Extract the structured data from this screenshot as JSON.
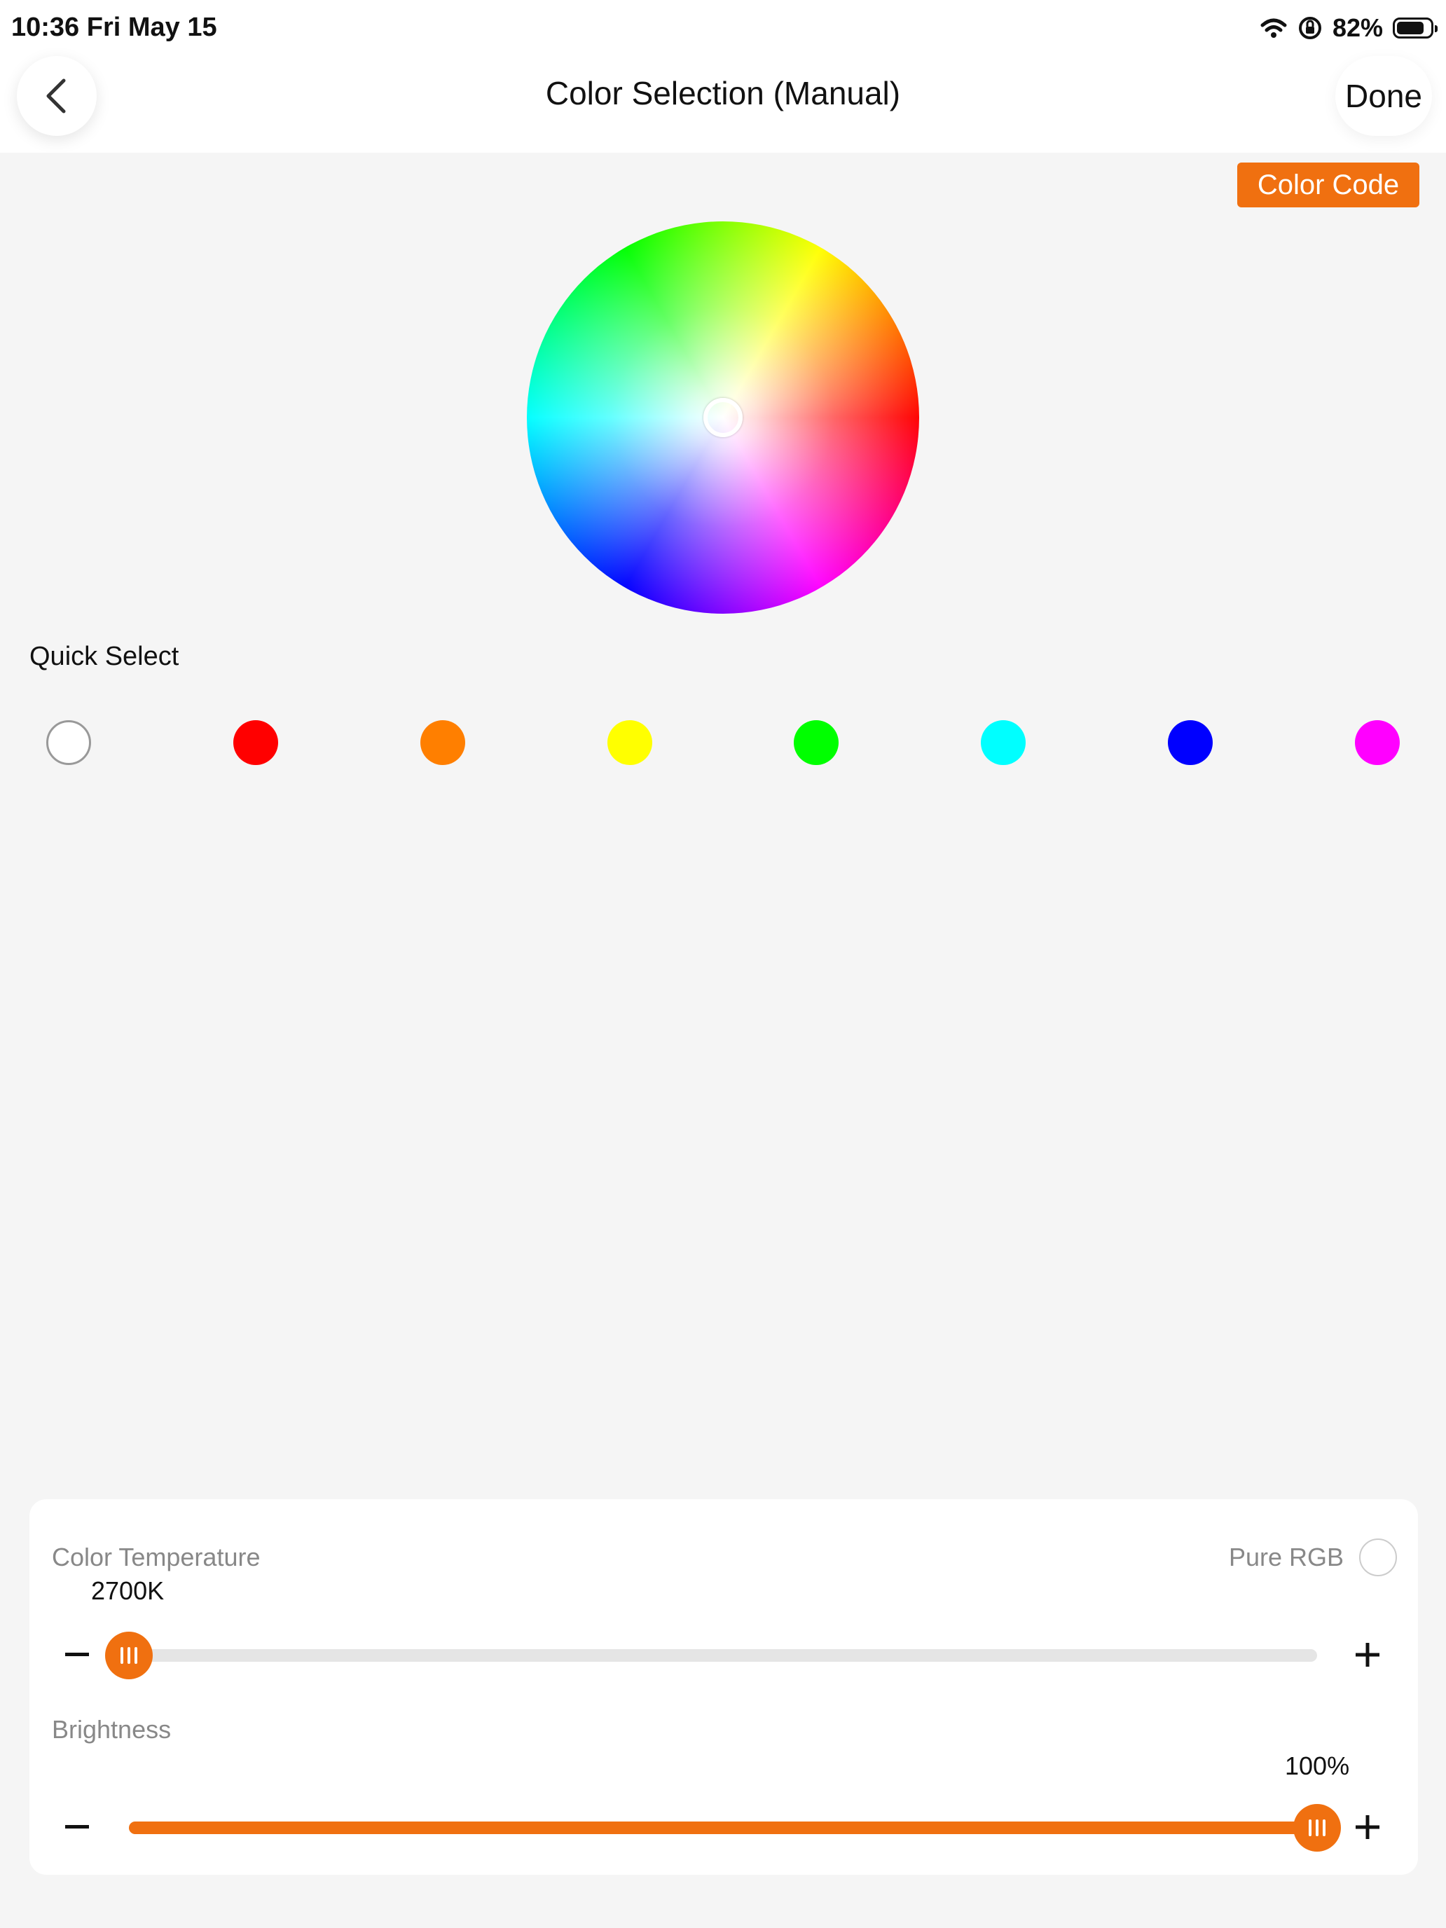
{
  "status_bar": {
    "time_date": "10:36   Fri May 15",
    "battery_percent": "82%",
    "battery_level": 0.82,
    "icons": [
      "wifi-icon",
      "orientation-lock-icon",
      "battery-icon"
    ]
  },
  "nav": {
    "back_icon": "chevron-left-icon",
    "title": "Color Selection (Manual)",
    "done_label": "Done"
  },
  "color_code_label": "Color Code",
  "wheel": {
    "selection": "center"
  },
  "quick_select": {
    "label": "Quick Select",
    "colors": [
      "#ffffff",
      "#ff0000",
      "#ff7f00",
      "#ffff00",
      "#00ff00",
      "#00ffff",
      "#0000ff",
      "#ff00ff"
    ]
  },
  "controls": {
    "color_temperature": {
      "label": "Color Temperature",
      "value": "2700K",
      "level": 0.0
    },
    "pure_rgb": {
      "label": "Pure RGB",
      "checked": false
    },
    "brightness": {
      "label": "Brightness",
      "value": "100%",
      "level": 1.0
    }
  },
  "colors": {
    "accent": "#f07010",
    "track": "#e5e5e5",
    "background": "#f5f5f5"
  }
}
